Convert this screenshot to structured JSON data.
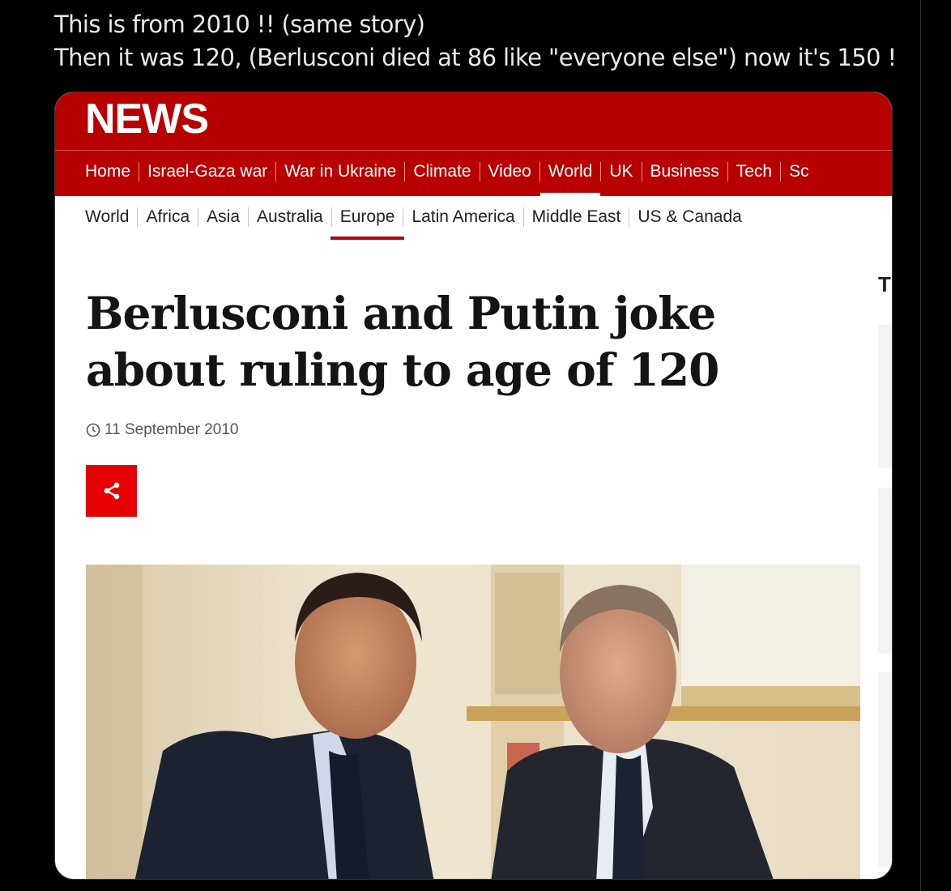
{
  "tweet": {
    "line1": "This is from 2010 !! (same story)",
    "line2": "Then it was 120, (Berlusconi died at 86 like \"everyone else\") now it's 150 !"
  },
  "card": {
    "logo": "NEWS",
    "primary_nav": [
      "Home",
      "Israel-Gaza war",
      "War in Ukraine",
      "Climate",
      "Video",
      "World",
      "UK",
      "Business",
      "Tech",
      "Sc"
    ],
    "primary_active": "World",
    "secondary_nav": [
      "World",
      "Africa",
      "Asia",
      "Australia",
      "Europe",
      "Latin America",
      "Middle East",
      "US & Canada"
    ],
    "secondary_active": "Europe",
    "headline": "Berlusconi and Putin joke about ruling to age of 120",
    "date": "11 September 2010",
    "sidebar_letter": "T",
    "colors": {
      "masthead": "#b80000",
      "share": "#e60000",
      "active_underline": "#b80000"
    },
    "icons": {
      "clock": "clock-icon",
      "share": "share-icon"
    }
  }
}
